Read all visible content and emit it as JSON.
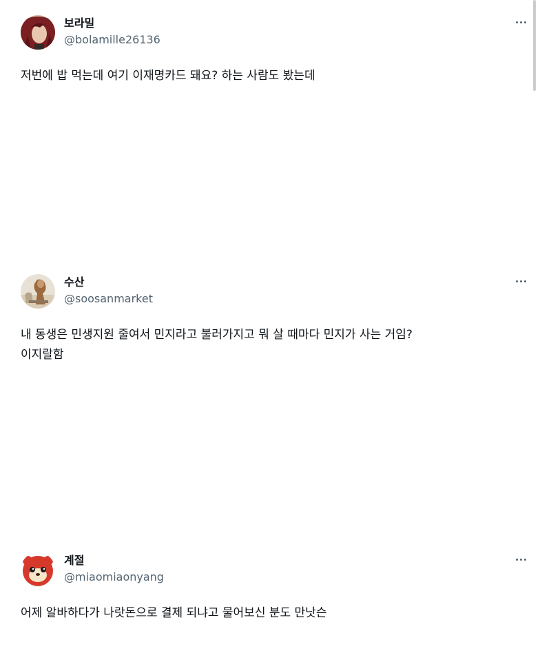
{
  "tweets": [
    {
      "display_name": "보라밀",
      "handle": "@bolamille26136",
      "text": "저번에 밥 먹는데 여기 이재명카드 돼요? 하는 사람도 봤는데",
      "avatar": "avatar-red-hair-character"
    },
    {
      "display_name": "수산",
      "handle": "@soosanmarket",
      "text": "내 동생은 민생지원 줄여서 민지라고 불러가지고 뭐 살 때마다 민지가 사는 거임?\n이지랄함",
      "avatar": "avatar-painting-figure"
    },
    {
      "display_name": "계절",
      "handle": "@miaomiaonyang",
      "text": "어제 알바하다가 나랏돈으로 결제 되냐고 물어보신 분도 만낫슨",
      "avatar": "avatar-red-cartoon-character"
    }
  ],
  "colors": {
    "text_primary": "#0f1419",
    "text_secondary": "#536471",
    "background": "#ffffff"
  },
  "icons": {
    "more": "more-horizontal-icon"
  }
}
